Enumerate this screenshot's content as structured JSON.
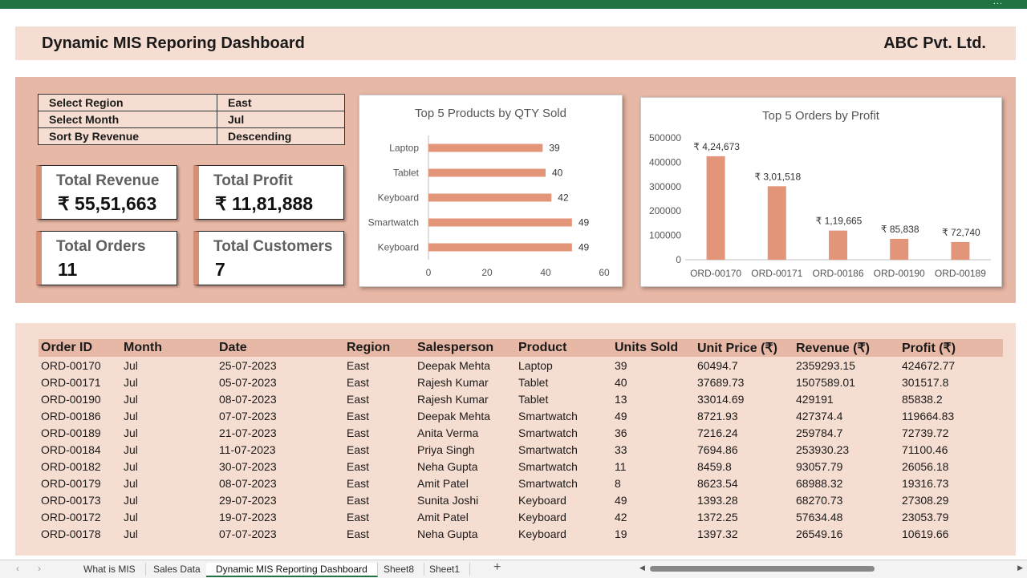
{
  "app": {
    "window_menu_dots": "..."
  },
  "header": {
    "title": "Dynamic MIS Reporing Dashboard",
    "company": "ABC Pvt. Ltd."
  },
  "filters": [
    {
      "label": "Select Region",
      "value": "East"
    },
    {
      "label": "Select Month",
      "value": "Jul"
    },
    {
      "label": "Sort By Revenue",
      "value": "Descending"
    }
  ],
  "kpis": {
    "revenue": {
      "label": "Total Revenue",
      "value": "₹ 55,51,663"
    },
    "profit": {
      "label": "Total Profit",
      "value": "₹ 11,81,888"
    },
    "orders": {
      "label": "Total Orders",
      "value": "11"
    },
    "customers": {
      "label": "Total Customers",
      "value": "7"
    }
  },
  "colors": {
    "bar": "#e3957a",
    "accent": "#d98f74",
    "panel_dark": "#e8b8a6",
    "panel_light": "#f6ddd1",
    "excel_green": "#217346"
  },
  "chart_data": [
    {
      "type": "bar",
      "orientation": "horizontal",
      "title": "Top 5 Products by QTY Sold",
      "categories": [
        "Laptop",
        "Tablet",
        "Keyboard",
        "Smartwatch",
        "Keyboard"
      ],
      "values": [
        39,
        40,
        42,
        49,
        49
      ],
      "xlim": [
        0,
        60
      ],
      "x_ticks": [
        0,
        20,
        40,
        60
      ],
      "data_labels": [
        "39",
        "40",
        "42",
        "49",
        "49"
      ],
      "grid": false
    },
    {
      "type": "bar",
      "title": "Top 5 Orders by Profit",
      "categories": [
        "ORD-00170",
        "ORD-00171",
        "ORD-00186",
        "ORD-00190",
        "ORD-00189"
      ],
      "values": [
        424673,
        301518,
        119665,
        85838,
        72740
      ],
      "ylim": [
        0,
        500000
      ],
      "y_ticks": [
        0,
        100000,
        200000,
        300000,
        400000,
        500000
      ],
      "data_labels": [
        "₹ 4,24,673",
        "₹ 3,01,518",
        "₹ 1,19,665",
        "₹ 85,838",
        "₹ 72,740"
      ],
      "grid": false
    }
  ],
  "table": {
    "columns": [
      "Order ID",
      "Month",
      "Date",
      "Region",
      "Salesperson",
      "Product",
      "Units Sold",
      "Unit Price (₹)",
      "Revenue (₹)",
      "Profit (₹)"
    ],
    "rows": [
      [
        "ORD-00170",
        "Jul",
        "25-07-2023",
        "East",
        "Deepak Mehta",
        "Laptop",
        "39",
        "60494.7",
        "2359293.15",
        "424672.77"
      ],
      [
        "ORD-00171",
        "Jul",
        "05-07-2023",
        "East",
        "Rajesh Kumar",
        "Tablet",
        "40",
        "37689.73",
        "1507589.01",
        "301517.8"
      ],
      [
        "ORD-00190",
        "Jul",
        "08-07-2023",
        "East",
        "Rajesh Kumar",
        "Tablet",
        "13",
        "33014.69",
        "429191",
        "85838.2"
      ],
      [
        "ORD-00186",
        "Jul",
        "07-07-2023",
        "East",
        "Deepak Mehta",
        "Smartwatch",
        "49",
        "8721.93",
        "427374.4",
        "119664.83"
      ],
      [
        "ORD-00189",
        "Jul",
        "21-07-2023",
        "East",
        "Anita Verma",
        "Smartwatch",
        "36",
        "7216.24",
        "259784.7",
        "72739.72"
      ],
      [
        "ORD-00184",
        "Jul",
        "11-07-2023",
        "East",
        "Priya Singh",
        "Smartwatch",
        "33",
        "7694.86",
        "253930.23",
        "71100.46"
      ],
      [
        "ORD-00182",
        "Jul",
        "30-07-2023",
        "East",
        "Neha Gupta",
        "Smartwatch",
        "11",
        "8459.8",
        "93057.79",
        "26056.18"
      ],
      [
        "ORD-00179",
        "Jul",
        "08-07-2023",
        "East",
        "Amit Patel",
        "Smartwatch",
        "8",
        "8623.54",
        "68988.32",
        "19316.73"
      ],
      [
        "ORD-00173",
        "Jul",
        "29-07-2023",
        "East",
        "Sunita Joshi",
        "Keyboard",
        "49",
        "1393.28",
        "68270.73",
        "27308.29"
      ],
      [
        "ORD-00172",
        "Jul",
        "19-07-2023",
        "East",
        "Amit Patel",
        "Keyboard",
        "42",
        "1372.25",
        "57634.48",
        "23053.79"
      ],
      [
        "ORD-00178",
        "Jul",
        "07-07-2023",
        "East",
        "Neha Gupta",
        "Keyboard",
        "19",
        "1397.32",
        "26549.16",
        "10619.66"
      ]
    ]
  },
  "sheet_tabs": {
    "items": [
      "What is MIS",
      "Sales Data",
      "Dynamic MIS Reporting Dashboard",
      "Sheet8",
      "Sheet1"
    ],
    "active_index": 2,
    "add_symbol": "+",
    "prev_symbol": "‹",
    "next_symbol": "›",
    "scroll_left_symbol": "◀",
    "scroll_right_symbol": "▶"
  }
}
